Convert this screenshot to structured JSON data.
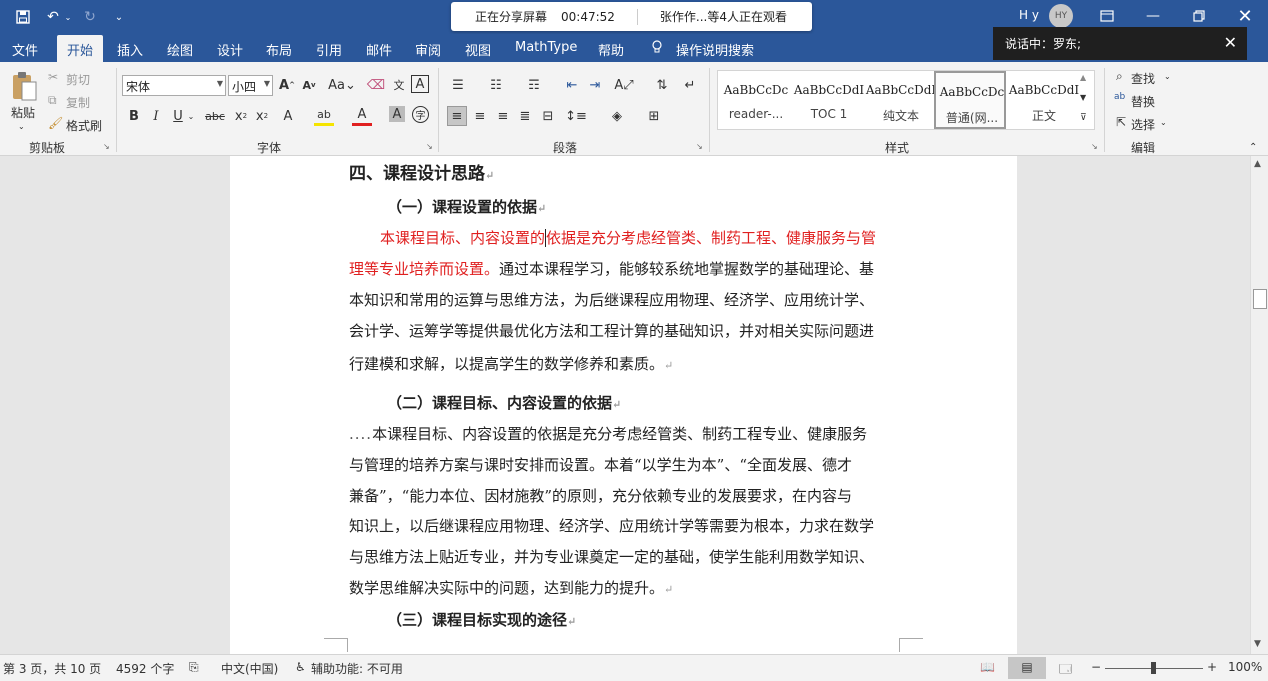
{
  "titlebar": {
    "share_status": "正在分享屏幕",
    "timer": "00:47:52",
    "viewers": "张作作...等4人正在观看",
    "user_name": "H y",
    "avatar_initials": "HY"
  },
  "menubar": {
    "tabs": [
      "文件",
      "开始",
      "插入",
      "绘图",
      "设计",
      "布局",
      "引用",
      "邮件",
      "审阅",
      "视图",
      "MathType",
      "帮助"
    ],
    "search_label": "操作说明搜索"
  },
  "speaker_banner": {
    "text": "说话中：罗东;"
  },
  "ribbon": {
    "clipboard": {
      "paste": "粘贴",
      "cut": "剪切",
      "copy": "复制",
      "format_painter": "格式刷",
      "group": "剪贴板"
    },
    "font": {
      "name": "宋体",
      "size": "小四",
      "group": "字体"
    },
    "paragraph": {
      "group": "段落"
    },
    "styles": {
      "items": [
        {
          "preview": "AaBbCcDc",
          "name": "reader-..."
        },
        {
          "preview": "AaBbCcDdI",
          "name": "TOC 1"
        },
        {
          "preview": "AaBbCcDdI",
          "name": "纯文本"
        },
        {
          "preview": "AaBbCcDc",
          "name": "普通(网..."
        },
        {
          "preview": "AaBbCcDdI",
          "name": "正文"
        }
      ],
      "group": "样式"
    },
    "editing": {
      "find": "查找",
      "replace": "替换",
      "select": "选择",
      "group": "编辑"
    }
  },
  "document": {
    "heading": "四、课程设计思路",
    "sub1": "（一）课程设置的依据",
    "p1_red_a": "本课程目标、内容设置的",
    "p1_red_b": "依据是充分考虑经管类、制药工程、健康服务与管",
    "p1_l2_red": "理等专业培养而设置。",
    "p1_l2_rest": "通过本课程学习，能够较系统地掌握数学的基础理论、基",
    "p1_l3": "本知识和常用的运算与思维方法，为后继课程应用物理、经济学、应用统计学、",
    "p1_l4": "会计学、运筹学等提供最优化方法和工程计算的基础知识，并对相关实际问题进",
    "p1_l5": "行建模和求解，以提高学生的数学修养和素质。",
    "sub2": "（二）课程目标、内容设置的依据",
    "p2_dots": "....",
    "p2_l1": "本课程目标、内容设置的依据是充分考虑经管类、制药工程专业、健康服务",
    "p2_l2": "与管理的培养方案与课时安排而设置。本着“以学生为本”、“全面发展、德才",
    "p2_l3": "兼备”，“能力本位、因材施教”的原则，充分依赖专业的发展要求，在内容与",
    "p2_l4": "知识上，以后继课程应用物理、经济学、应用统计学等需要为根本，力求在数学",
    "p2_l5": "与思维方法上贴近专业，并为专业课奠定一定的基础，使学生能利用数学知识、",
    "p2_l6": "数学思维解决实际中的问题，达到能力的提升。",
    "sub3": "（三）课程目标实现的途径",
    "para_mark": "↵"
  },
  "statusbar": {
    "page": "第 3 页，共 10 页",
    "words": "4592 个字",
    "lang": "中文(中国)",
    "accessibility": "辅助功能: 不可用",
    "zoom": "100%"
  },
  "colors": {
    "accent": "#2b579a",
    "red_text": "#e02020"
  }
}
